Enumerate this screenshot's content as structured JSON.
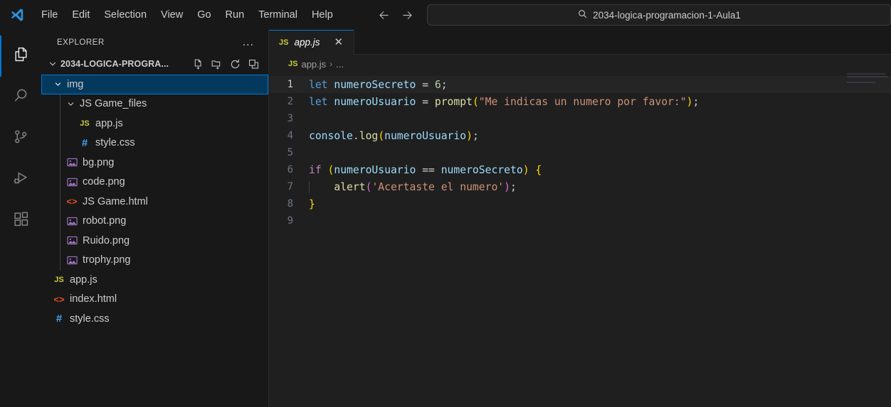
{
  "titlebar": {
    "logo_icon": "vscode-logo-icon",
    "menus": [
      "File",
      "Edit",
      "Selection",
      "View",
      "Go",
      "Run",
      "Terminal",
      "Help"
    ],
    "nav_back_icon": "arrow-left-icon",
    "nav_forward_icon": "arrow-forward-icon",
    "search": {
      "icon": "search-icon",
      "value": "2034-logica-programacion-1-Aula1",
      "placeholder": "Search"
    }
  },
  "activitybar": {
    "items": [
      {
        "name": "explorer",
        "icon": "files-icon",
        "active": true
      },
      {
        "name": "search",
        "icon": "search-icon",
        "active": false
      },
      {
        "name": "source-control",
        "icon": "source-control-icon",
        "active": false
      },
      {
        "name": "run-and-debug",
        "icon": "run-debug-icon",
        "active": false
      },
      {
        "name": "extensions",
        "icon": "extensions-icon",
        "active": false
      }
    ]
  },
  "sidebar": {
    "title": "EXPLORER",
    "more_actions_label": "...",
    "folder": {
      "name": "2034-LOGICA-PROGRA...",
      "expanded": true,
      "actions": [
        {
          "name": "new-file",
          "icon": "new-file-icon"
        },
        {
          "name": "new-folder",
          "icon": "new-folder-icon"
        },
        {
          "name": "refresh",
          "icon": "refresh-icon"
        },
        {
          "name": "collapse-all",
          "icon": "collapse-all-icon"
        }
      ]
    },
    "tree": [
      {
        "label": "img",
        "icon": "folder",
        "kind": "folder",
        "depth": 1,
        "expanded": true,
        "selected": true
      },
      {
        "label": "JS Game_files",
        "icon": "folder",
        "kind": "folder",
        "depth": 2,
        "expanded": true,
        "selected": false
      },
      {
        "label": "app.js",
        "icon": "js-icon",
        "kind": "file",
        "depth": 3,
        "selected": false
      },
      {
        "label": "style.css",
        "icon": "css-icon",
        "kind": "file",
        "depth": 3,
        "selected": false
      },
      {
        "label": "bg.png",
        "icon": "image-icon",
        "kind": "file",
        "depth": 2,
        "selected": false
      },
      {
        "label": "code.png",
        "icon": "image-icon",
        "kind": "file",
        "depth": 2,
        "selected": false
      },
      {
        "label": "JS Game.html",
        "icon": "html-icon",
        "kind": "file",
        "depth": 2,
        "selected": false
      },
      {
        "label": "robot.png",
        "icon": "image-icon",
        "kind": "file",
        "depth": 2,
        "selected": false
      },
      {
        "label": "Ruido.png",
        "icon": "image-icon",
        "kind": "file",
        "depth": 2,
        "selected": false
      },
      {
        "label": "trophy.png",
        "icon": "image-icon",
        "kind": "file",
        "depth": 2,
        "selected": false
      },
      {
        "label": "app.js",
        "icon": "js-icon",
        "kind": "file",
        "depth": 1,
        "selected": false
      },
      {
        "label": "index.html",
        "icon": "html-icon",
        "kind": "file",
        "depth": 1,
        "selected": false
      },
      {
        "label": "style.css",
        "icon": "css-icon",
        "kind": "file",
        "depth": 1,
        "selected": false
      }
    ]
  },
  "editor": {
    "tabs": [
      {
        "label": "app.js",
        "icon": "js-icon",
        "active": true,
        "preview": true,
        "close_label": "✕"
      }
    ],
    "breadcrumb": {
      "icon": "js-icon",
      "file": "app.js",
      "separator": "›",
      "symbol": "..."
    },
    "lines": [
      {
        "n": "1",
        "active": true,
        "tokens": [
          {
            "t": "let",
            "c": "t-kw"
          },
          {
            "t": " ",
            "c": "t-plain"
          },
          {
            "t": "numeroSecreto",
            "c": "t-var"
          },
          {
            "t": " ",
            "c": "t-plain"
          },
          {
            "t": "=",
            "c": "t-op"
          },
          {
            "t": " ",
            "c": "t-plain"
          },
          {
            "t": "6",
            "c": "t-num"
          },
          {
            "t": ";",
            "c": "t-plain"
          }
        ]
      },
      {
        "n": "2",
        "active": false,
        "tokens": [
          {
            "t": "let",
            "c": "t-kw"
          },
          {
            "t": " ",
            "c": "t-plain"
          },
          {
            "t": "numeroUsuario",
            "c": "t-var"
          },
          {
            "t": " ",
            "c": "t-plain"
          },
          {
            "t": "=",
            "c": "t-op"
          },
          {
            "t": " ",
            "c": "t-plain"
          },
          {
            "t": "prompt",
            "c": "t-fn"
          },
          {
            "t": "(",
            "c": "t-p1"
          },
          {
            "t": "\"Me indicas un numero por favor:\"",
            "c": "t-str"
          },
          {
            "t": ")",
            "c": "t-p1"
          },
          {
            "t": ";",
            "c": "t-plain"
          }
        ]
      },
      {
        "n": "3",
        "active": false,
        "tokens": []
      },
      {
        "n": "4",
        "active": false,
        "tokens": [
          {
            "t": "console",
            "c": "t-var"
          },
          {
            "t": ".",
            "c": "t-plain"
          },
          {
            "t": "log",
            "c": "t-fn"
          },
          {
            "t": "(",
            "c": "t-p1"
          },
          {
            "t": "numeroUsuario",
            "c": "t-var"
          },
          {
            "t": ")",
            "c": "t-p1"
          },
          {
            "t": ";",
            "c": "t-plain"
          }
        ]
      },
      {
        "n": "5",
        "active": false,
        "tokens": []
      },
      {
        "n": "6",
        "active": false,
        "tokens": [
          {
            "t": "if",
            "c": "t-kwctl"
          },
          {
            "t": " ",
            "c": "t-plain"
          },
          {
            "t": "(",
            "c": "t-p1"
          },
          {
            "t": "numeroUsuario",
            "c": "t-var"
          },
          {
            "t": " ",
            "c": "t-plain"
          },
          {
            "t": "==",
            "c": "t-op"
          },
          {
            "t": " ",
            "c": "t-plain"
          },
          {
            "t": "numeroSecreto",
            "c": "t-var"
          },
          {
            "t": ")",
            "c": "t-p1"
          },
          {
            "t": " ",
            "c": "t-plain"
          },
          {
            "t": "{",
            "c": "t-p1"
          }
        ]
      },
      {
        "n": "7",
        "active": false,
        "indent_guide": true,
        "tokens": [
          {
            "t": "    ",
            "c": "t-plain"
          },
          {
            "t": "alert",
            "c": "t-fn"
          },
          {
            "t": "(",
            "c": "t-p2"
          },
          {
            "t": "'Acertaste el numero'",
            "c": "t-str"
          },
          {
            "t": ")",
            "c": "t-p2"
          },
          {
            "t": ";",
            "c": "t-plain"
          }
        ]
      },
      {
        "n": "8",
        "active": false,
        "tokens": [
          {
            "t": "}",
            "c": "t-p1"
          }
        ]
      },
      {
        "n": "9",
        "active": false,
        "tokens": []
      }
    ]
  },
  "colors": {
    "accent": "#0078d4",
    "selection": "#04395e",
    "sidebar_bg": "#181818",
    "editor_bg": "#1f1f1f"
  }
}
